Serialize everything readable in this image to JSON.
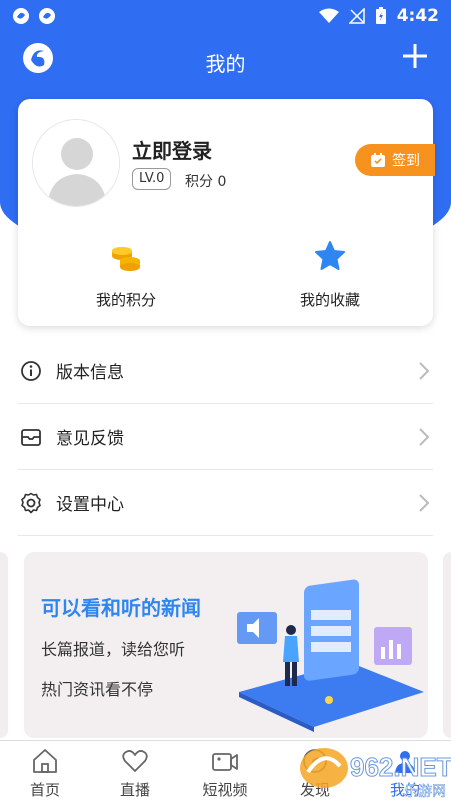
{
  "status_bar": {
    "time": "4:42"
  },
  "header": {
    "title": "我的"
  },
  "profile": {
    "login_label": "立即登录",
    "level": "LV.0",
    "points": "积分 0",
    "signin_label": "签到"
  },
  "card_actions": [
    {
      "label": "我的积分",
      "icon": "coins-icon"
    },
    {
      "label": "我的收藏",
      "icon": "star-icon"
    }
  ],
  "menu": [
    {
      "label": "版本信息",
      "icon": "info-icon"
    },
    {
      "label": "意见反馈",
      "icon": "feedback-mail-icon"
    },
    {
      "label": "设置中心",
      "icon": "gear-icon"
    }
  ],
  "banner": {
    "title": "可以看和听的新闻",
    "line1": "长篇报道，读给您听",
    "line2": "热门资讯看不停"
  },
  "tabs": [
    {
      "label": "首页",
      "icon": "home-icon"
    },
    {
      "label": "直播",
      "icon": "heart-icon"
    },
    {
      "label": "短视频",
      "icon": "video-icon"
    },
    {
      "label": "发现",
      "icon": "discover-icon"
    },
    {
      "label": "我的",
      "icon": "profile-icon"
    }
  ],
  "watermark": {
    "text": "962.NET",
    "subtext": "乐游网"
  },
  "colors": {
    "primary": "#2f6df2",
    "accent_orange": "#f7921e",
    "banner_title": "#2f86f0",
    "coin_gold": "#f5b400"
  }
}
